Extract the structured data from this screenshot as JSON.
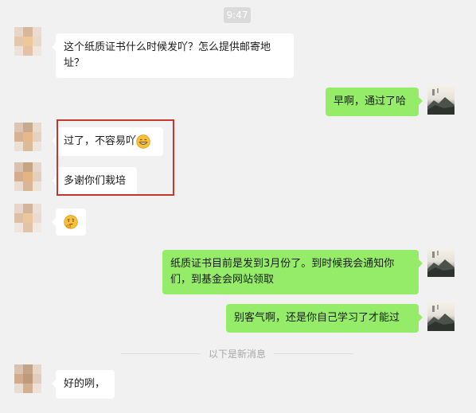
{
  "timestamp": "9:47",
  "messages": {
    "m1": "这个纸质证书什么时候发吖？怎么提供邮寄地址？",
    "m2": "早啊，通过了哈",
    "m3": "过了，不容易吖",
    "m4": "多谢你们栽培",
    "m5": "纸质证书目前是发到3月份了。到时候我会通知你们，到基金会网站领取",
    "m6": "别客气啊，还是你自己学习了才能过",
    "m7": "好的咧，"
  },
  "divider_text": "以下是新消息",
  "icons": {
    "grin": "grinning-face-emoji",
    "thinking": "thinking-face-emoji"
  },
  "colors": {
    "sent_bubble": "#95ec69",
    "received_bubble": "#ffffff",
    "background": "#f1f1f1",
    "highlight": "#c0392b"
  }
}
